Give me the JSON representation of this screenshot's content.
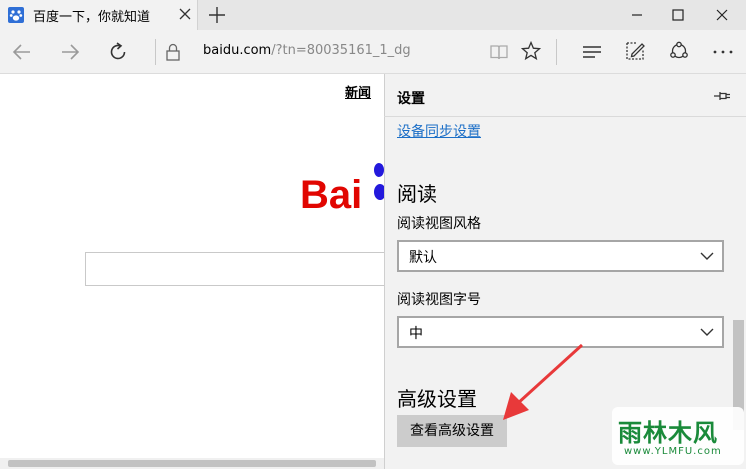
{
  "tab": {
    "title": "百度一下，你就知道"
  },
  "address": {
    "host": "baidu.com",
    "path": "/?tn=80035161_1_dg"
  },
  "page": {
    "news_link": "新闻",
    "logo_text": "Bai"
  },
  "settings": {
    "title": "设置",
    "sync_link": "设备同步设置",
    "reading_heading": "阅读",
    "style_label": "阅读视图风格",
    "style_value": "默认",
    "size_label": "阅读视图字号",
    "size_value": "中",
    "advanced_heading": "高级设置",
    "advanced_button": "查看高级设置"
  },
  "watermark": {
    "text": "雨林木风",
    "url": "www.YLMFU.com"
  },
  "colors": {
    "link": "#1c6fc7",
    "baidu_red": "#e10601",
    "baidu_blue": "#2319dc",
    "arrow": "#e8393a"
  },
  "icons": {
    "favicon": "baidu-paw-icon",
    "back": "arrow-left-icon",
    "forward": "arrow-right-icon",
    "refresh": "refresh-icon",
    "lock": "lock-icon",
    "reading_view": "book-icon",
    "favorite": "star-icon",
    "hub": "hub-lines-icon",
    "note": "pen-note-icon",
    "share": "share-icon",
    "more": "more-dots-icon",
    "pin": "pin-icon"
  }
}
